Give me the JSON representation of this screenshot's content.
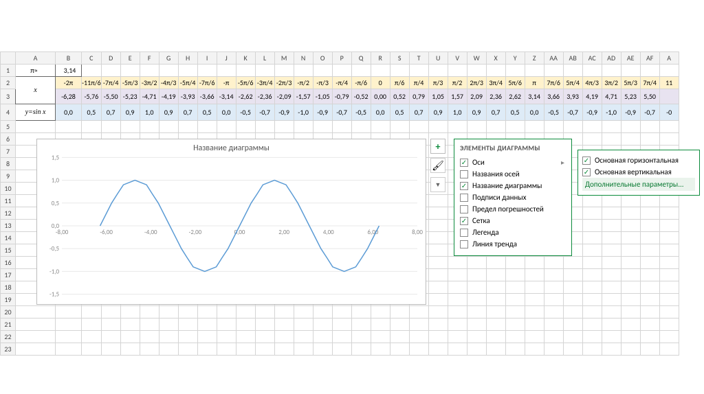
{
  "columns": [
    "A",
    "B",
    "C",
    "D",
    "E",
    "F",
    "G",
    "H",
    "I",
    "J",
    "K",
    "L",
    "M",
    "N",
    "O",
    "P",
    "Q",
    "R",
    "S",
    "T",
    "U",
    "V",
    "W",
    "X",
    "Y",
    "Z",
    "AA",
    "AB",
    "AC",
    "AD",
    "AE",
    "AF",
    "A"
  ],
  "row_numbers": [
    "1",
    "2",
    "3",
    "4",
    "5",
    "6",
    "7",
    "8",
    "9",
    "10",
    "11",
    "12",
    "13",
    "14",
    "15",
    "16",
    "17",
    "18",
    "19",
    "20",
    "21",
    "22",
    "23"
  ],
  "pi_label": "π≈",
  "pi_value": "3,14",
  "x_label": "x",
  "x_ticks": [
    "-2π",
    "-11π/6",
    "-7π/4",
    "-5π/3",
    "-3π/2",
    "-4π/3",
    "-5π/4",
    "-7π/6",
    "-π",
    "-5π/6",
    "-3π/4",
    "-2π/3",
    "-π/2",
    "-π/3",
    "-π/4",
    "-π/6",
    "0",
    "π/6",
    "π/4",
    "π/3",
    "π/2",
    "2π/3",
    "3π/4",
    "5π/6",
    "π",
    "7π/6",
    "5π/4",
    "4π/3",
    "3π/2",
    "5π/3",
    "7π/4",
    "11"
  ],
  "x_vals": [
    "-6,28",
    "-5,76",
    "-5,50",
    "-5,23",
    "-4,71",
    "-4,19",
    "-3,93",
    "-3,66",
    "-3,14",
    "-2,62",
    "-2,36",
    "-2,09",
    "-1,57",
    "-1,05",
    "-0,79",
    "-0,52",
    "0,00",
    "0,52",
    "0,79",
    "1,05",
    "1,57",
    "2,09",
    "2,36",
    "2,62",
    "3,14",
    "3,66",
    "3,93",
    "4,19",
    "4,71",
    "5,23",
    "5,50",
    ""
  ],
  "y_label": "y=sin x",
  "y_vals": [
    "0,0",
    "0,5",
    "0,7",
    "0,9",
    "1,0",
    "0,9",
    "0,7",
    "0,5",
    "0,0",
    "-0,5",
    "-0,7",
    "-0,9",
    "-1,0",
    "-0,9",
    "-0,7",
    "-0,5",
    "0,0",
    "0,5",
    "0,7",
    "0,9",
    "1,0",
    "0,9",
    "0,7",
    "0,5",
    "0,0",
    "-0,5",
    "-0,7",
    "-0,9",
    "-1,0",
    "-0,9",
    "-0,7",
    "-0"
  ],
  "chart_title": "Название диаграммы",
  "chart_data": {
    "type": "line",
    "title": "Название диаграммы",
    "xlabel": "",
    "ylabel": "",
    "xlim": [
      -8,
      8
    ],
    "ylim": [
      -1.5,
      1.5
    ],
    "xticks": [
      -8,
      -6,
      -4,
      -2,
      0,
      2,
      4,
      6,
      8
    ],
    "xtick_labels": [
      "-8,00",
      "-6,00",
      "-4,00",
      "-2,00",
      "0,00",
      "2,00",
      "4,00",
      "6,00",
      "8,00"
    ],
    "yticks": [
      -1.5,
      -1.0,
      -0.5,
      0,
      0.5,
      1.0,
      1.5
    ],
    "ytick_labels": [
      "-1,5",
      "-1,0",
      "-0,5",
      "0,0",
      "0,5",
      "1,0",
      "1,5"
    ],
    "series": [
      {
        "name": "sin x",
        "x": [
          -6.28,
          -5.76,
          -5.5,
          -5.23,
          -4.71,
          -4.19,
          -3.93,
          -3.66,
          -3.14,
          -2.62,
          -2.36,
          -2.09,
          -1.57,
          -1.05,
          -0.79,
          -0.52,
          0,
          0.52,
          0.79,
          1.05,
          1.57,
          2.09,
          2.36,
          2.62,
          3.14,
          3.66,
          3.93,
          4.19,
          4.71,
          5.23,
          5.5,
          5.76,
          6.28
        ],
        "y": [
          0.0,
          0.5,
          0.7,
          0.9,
          1.0,
          0.9,
          0.7,
          0.5,
          0.0,
          -0.5,
          -0.7,
          -0.9,
          -1.0,
          -0.9,
          -0.7,
          -0.5,
          0.0,
          0.5,
          0.7,
          0.9,
          1.0,
          0.9,
          0.7,
          0.5,
          0.0,
          -0.5,
          -0.7,
          -0.9,
          -1.0,
          -0.9,
          -0.7,
          -0.5,
          0.0
        ]
      }
    ]
  },
  "side_icons": {
    "plus": "+",
    "brush": "🖌",
    "filter": "▼"
  },
  "panel_main_title": "ЭЛЕМЕНТЫ ДИАГРАММЫ",
  "panel_main_items": [
    {
      "label": "Оси",
      "checked": true,
      "arrow": true
    },
    {
      "label": "Названия осей",
      "checked": false
    },
    {
      "label": "Название диаграммы",
      "checked": true
    },
    {
      "label": "Подписи данных",
      "checked": false
    },
    {
      "label": "Предел погрешностей",
      "checked": false
    },
    {
      "label": "Сетка",
      "checked": true
    },
    {
      "label": "Легенда",
      "checked": false
    },
    {
      "label": "Линия тренда",
      "checked": false
    }
  ],
  "panel_sub_items": [
    {
      "label": "Основная горизонтальная",
      "checked": true
    },
    {
      "label": "Основная вертикальная",
      "checked": true
    }
  ],
  "panel_sub_more": "Дополнительные параметры..."
}
